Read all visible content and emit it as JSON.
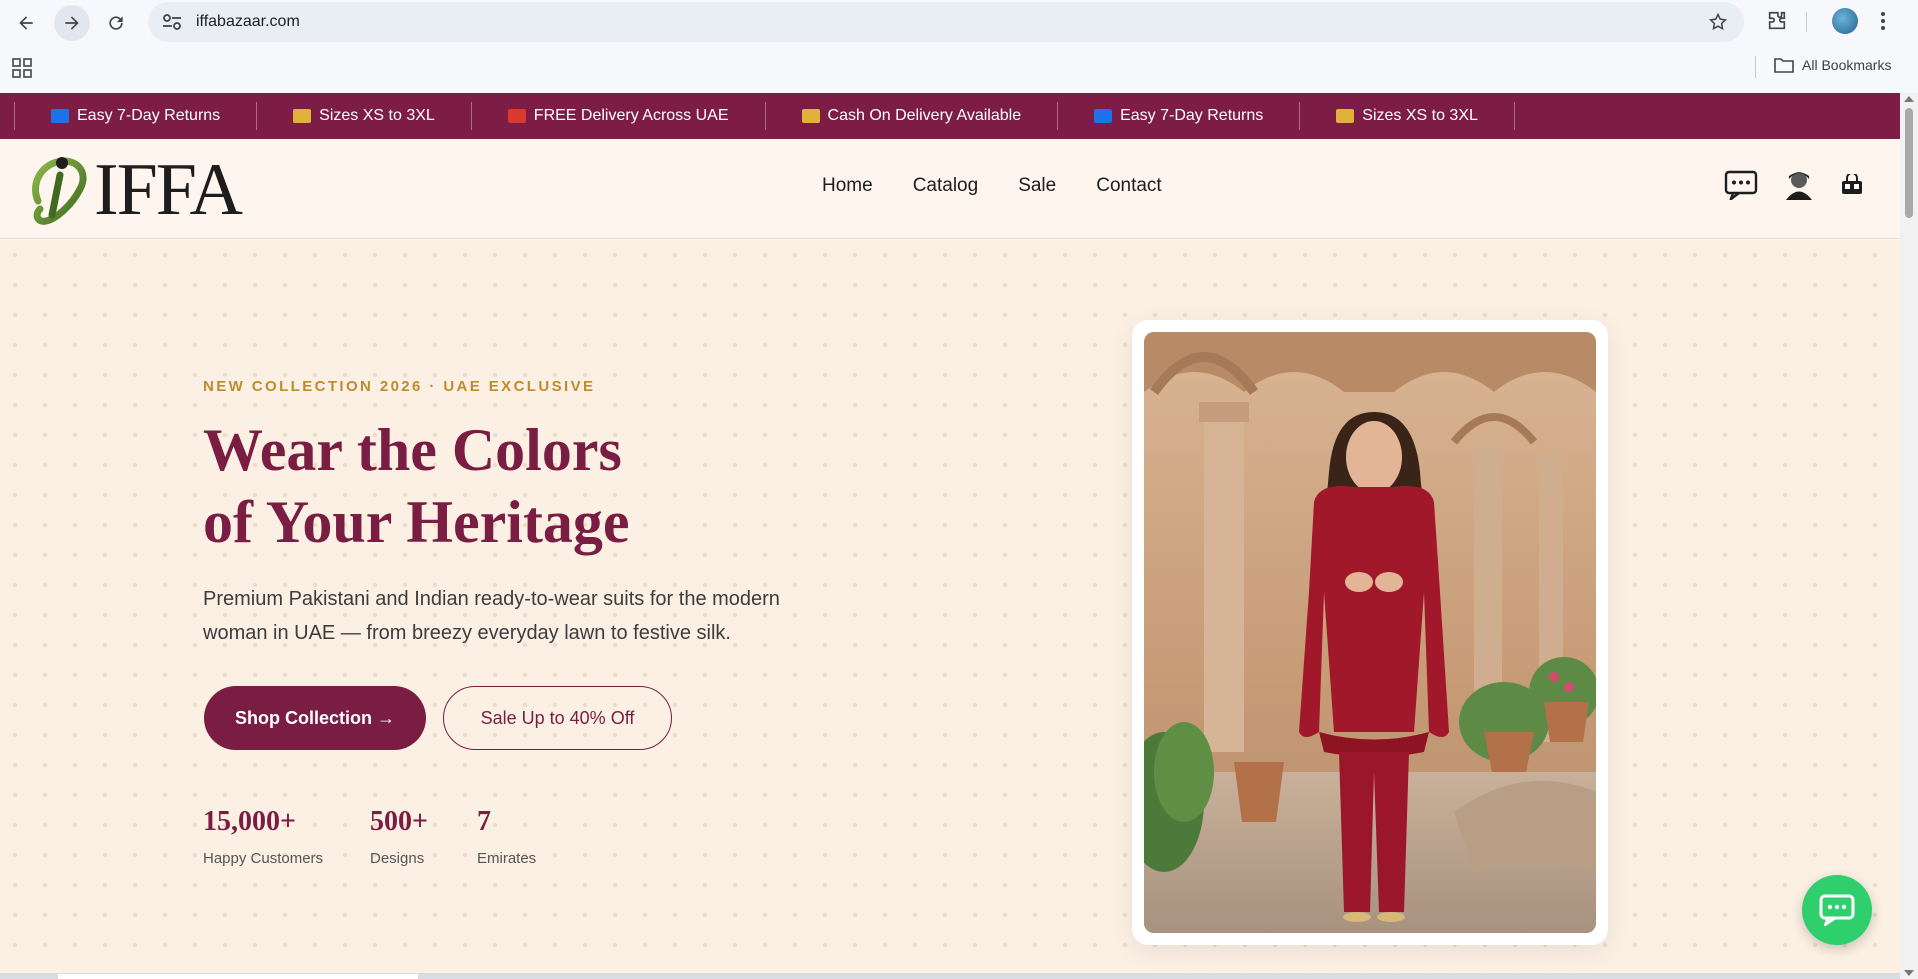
{
  "browser": {
    "url": "iffabazaar.com",
    "bookmarks_label": "All Bookmarks"
  },
  "announcements": [
    {
      "icon": "return-icon",
      "text": "Easy 7-Day Returns",
      "color": "#1a73e8"
    },
    {
      "icon": "ruler-icon",
      "text": "Sizes XS to 3XL",
      "color": "#e0b23a"
    },
    {
      "icon": "truck-icon",
      "text": "FREE Delivery Across UAE",
      "color": "#d93a2b"
    },
    {
      "icon": "card-icon",
      "text": "Cash On Delivery Available",
      "color": "#e0b23a"
    },
    {
      "icon": "return-icon",
      "text": "Easy 7-Day Returns",
      "color": "#1a73e8"
    },
    {
      "icon": "ruler-icon",
      "text": "Sizes XS to 3XL",
      "color": "#e0b23a"
    }
  ],
  "header": {
    "logo_text": "IFFA",
    "menu": [
      "Home",
      "Catalog",
      "Sale",
      "Contact"
    ]
  },
  "hero": {
    "eyebrow": "NEW COLLECTION 2026 · UAE EXCLUSIVE",
    "headline_line1": "Wear the Colors",
    "headline_line2": "of Your Heritage",
    "subtitle": "Premium Pakistani and Indian ready-to-wear suits for the modern woman in UAE — from breezy everyday lawn to festive silk.",
    "primary_cta": "Shop Collection →",
    "secondary_cta": "Sale Up to 40% Off",
    "stats": [
      {
        "value": "15,000+",
        "label": "Happy Customers"
      },
      {
        "value": "500+",
        "label": "Designs"
      },
      {
        "value": "7",
        "label": "Emirates"
      }
    ]
  },
  "colors": {
    "brand": "#7a1d43",
    "announcement_bar": "#7d1d45",
    "accent_gold": "#c08b2c",
    "chat_green": "#2fcf6e"
  }
}
